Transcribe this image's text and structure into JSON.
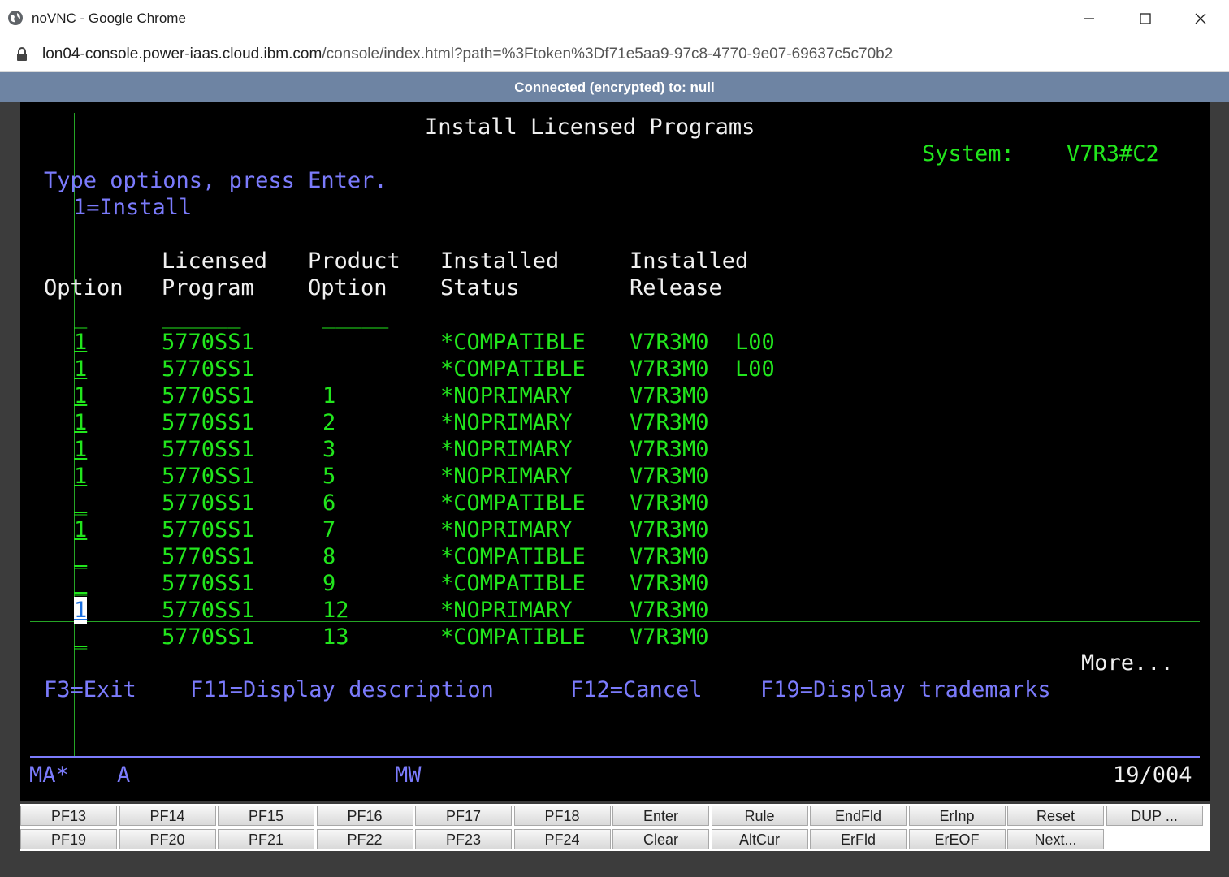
{
  "window": {
    "title": "noVNC - Google Chrome"
  },
  "address": {
    "host": "lon04-console.power-iaas.cloud.ibm.com",
    "path": "/console/index.html?path=%3Ftoken%3Df71e5aa9-97c8-4770-9e07-69637c5c70b2"
  },
  "vnc_status": "Connected (encrypted) to: null",
  "screen": {
    "title": "Install Licensed Programs",
    "system_label": "System:",
    "system_name": "V7R3#C2",
    "instructions": "Type options, press Enter.",
    "option_legend": "1=Install",
    "headers": {
      "option": "Option",
      "licensed_program": [
        "Licensed",
        "Program"
      ],
      "product_option": [
        "Product",
        "Option"
      ],
      "installed_status": [
        "Installed",
        "Status"
      ],
      "installed_release": [
        "Installed",
        "Release"
      ]
    },
    "rows": [
      {
        "option": "_",
        "program": "______",
        "product_option": "_____",
        "status": "",
        "release": ""
      },
      {
        "option": "1",
        "program": "5770SS1",
        "product_option": "",
        "status": "*COMPATIBLE",
        "release": "V7R3M0  L00"
      },
      {
        "option": "1",
        "program": "5770SS1",
        "product_option": "",
        "status": "*COMPATIBLE",
        "release": "V7R3M0  L00"
      },
      {
        "option": "1",
        "program": "5770SS1",
        "product_option": "1",
        "status": "*NOPRIMARY",
        "release": "V7R3M0"
      },
      {
        "option": "1",
        "program": "5770SS1",
        "product_option": "2",
        "status": "*NOPRIMARY",
        "release": "V7R3M0"
      },
      {
        "option": "1",
        "program": "5770SS1",
        "product_option": "3",
        "status": "*NOPRIMARY",
        "release": "V7R3M0"
      },
      {
        "option": "1",
        "program": "5770SS1",
        "product_option": "5",
        "status": "*NOPRIMARY",
        "release": "V7R3M0"
      },
      {
        "option": "_",
        "program": "5770SS1",
        "product_option": "6",
        "status": "*COMPATIBLE",
        "release": "V7R3M0"
      },
      {
        "option": "1",
        "program": "5770SS1",
        "product_option": "7",
        "status": "*NOPRIMARY",
        "release": "V7R3M0"
      },
      {
        "option": "_",
        "program": "5770SS1",
        "product_option": "8",
        "status": "*COMPATIBLE",
        "release": "V7R3M0"
      },
      {
        "option": "_",
        "program": "5770SS1",
        "product_option": "9",
        "status": "*COMPATIBLE",
        "release": "V7R3M0"
      },
      {
        "option": "1",
        "program": "5770SS1",
        "product_option": "12",
        "status": "*NOPRIMARY",
        "release": "V7R3M0"
      },
      {
        "option": "_",
        "program": "5770SS1",
        "product_option": "13",
        "status": "*COMPATIBLE",
        "release": "V7R3M0"
      }
    ],
    "more": "More...",
    "fkeys": [
      "F3=Exit",
      "F11=Display description",
      "F12=Cancel",
      "F19=Display trademarks"
    ],
    "status_line": {
      "left": "MA*",
      "mode": "A",
      "mid": "MW",
      "pos": "19/004"
    }
  },
  "keypad": {
    "row1": [
      "PF13",
      "PF14",
      "PF15",
      "PF16",
      "PF17",
      "PF18",
      "Enter",
      "Rule",
      "EndFld",
      "ErInp",
      "Reset",
      "DUP ..."
    ],
    "row2": [
      "PF19",
      "PF20",
      "PF21",
      "PF22",
      "PF23",
      "PF24",
      "Clear",
      "AltCur",
      "ErFld",
      "ErEOF",
      "Next..."
    ]
  }
}
